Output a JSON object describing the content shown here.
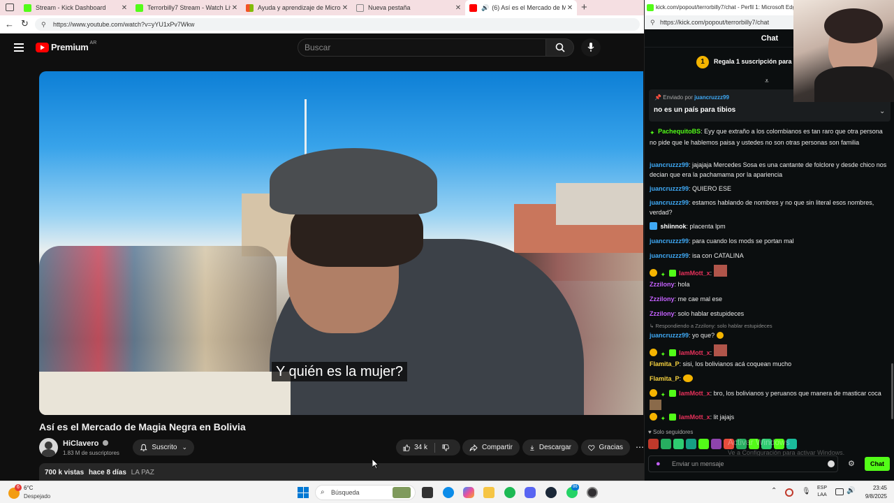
{
  "browser": {
    "tabs": [
      {
        "label": "Stream - Kick Dashboard",
        "color": "#53fc18"
      },
      {
        "label": "Terrorbilly7 Stream - Watch Live o",
        "color": "#53fc18"
      },
      {
        "label": "Ayuda y aprendizaje de Microsoft",
        "color": "#f35325"
      },
      {
        "label": "Nueva pestaña",
        "color": "#888888"
      },
      {
        "label": "(6) Así es el Mercado de Mag",
        "color": "#ff0000"
      }
    ],
    "url": "https://www.youtube.com/watch?v=yYU1xPv7Wkw"
  },
  "youtube": {
    "logo_text": "Premium",
    "logo_region": "AR",
    "search_placeholder": "Buscar",
    "subtitle": "Y quién es la mujer?",
    "title": "Así es el Mercado de Magia Negra en Bolivia",
    "channel": {
      "name": "HiClavero",
      "subscribers": "1.83 M de suscriptores"
    },
    "subscribe_label": "Suscrito",
    "likes": "34 k",
    "share_label": "Compartir",
    "download_label": "Descargar",
    "thanks_label": "Gracias",
    "views": "700 k vistas",
    "date": "hace 8 días",
    "location": "LA PAZ"
  },
  "kick": {
    "window_title": "kick.com/popout/terrorbilly7/chat - Perfil 1: Microsoft Edge",
    "url": "https://kick.com/popout/terrorbilly7/chat",
    "chat_title": "Chat",
    "gift_count": "1",
    "gift_text": "Regala 1 suscripción para te",
    "pinned": {
      "sent_by_label": "Enviado por",
      "sent_by_user": "juancruzzz99",
      "message": "no es un país para tibios"
    },
    "messages": [
      {
        "user": "PachequitoBS",
        "text": "Eyy que extraño a los colombianos es tan raro que otra persona no pide que le hablemos paisa y ustedes no son otras personas son familia"
      },
      {
        "user": "juancruzzz99",
        "text": "jajajaja Mercedes Sosa es una cantante de folclore y desde chico nos decian que era la pachamama por la apariencia"
      },
      {
        "user": "juancruzzz99",
        "text": "QUIERO ESE"
      },
      {
        "user": "juancruzzz99",
        "text": "estamos hablando de nombres y no que sin literal esos nombres, verdad?"
      },
      {
        "user": "shiinnok",
        "text": "placenta lpm"
      },
      {
        "user": "juancruzzz99",
        "text": "para cuando los mods se portan mal"
      },
      {
        "user": "juancruzzz99",
        "text": "isa con CATALINA"
      },
      {
        "user": "IamMott_x",
        "text": ""
      },
      {
        "user": "Zzzilony",
        "text": "hola"
      },
      {
        "user": "Zzzilony",
        "text": "me cae mal ese"
      },
      {
        "user": "Zzzilony",
        "text": "solo hablar estupideces"
      },
      {
        "user": "juancruzzz99",
        "text": "yo que?"
      },
      {
        "user": "IamMott_x",
        "text": ""
      },
      {
        "user": "Flamita_P",
        "text": "sisi, los bolivianos acá coquean mucho"
      },
      {
        "user": "Flamita_P",
        "text": ""
      },
      {
        "user": "IamMott_x",
        "text": "bro, los bolivianos y peruanos que manera de masticar coca"
      },
      {
        "user": "IamMott_x",
        "text": "lit jajajs"
      }
    ],
    "reply_note": "Respondiendo a Zzzilony: solo hablar estupideces",
    "followers_only": "Solo seguidores",
    "input_placeholder": "Enviar un mensaje",
    "send_label": "Chat",
    "watermark_title": "Activar Windows",
    "watermark_sub": "Ve a Configuración para activar Windows."
  },
  "taskbar": {
    "weather_badge": "6",
    "temperature": "6°C",
    "weather": "Despejado",
    "search_label": "Búsqueda",
    "whatsapp_badge": "86",
    "lang_top": "ESP",
    "lang_bottom": "LAA",
    "time": "23:45",
    "date": "9/8/2025"
  }
}
